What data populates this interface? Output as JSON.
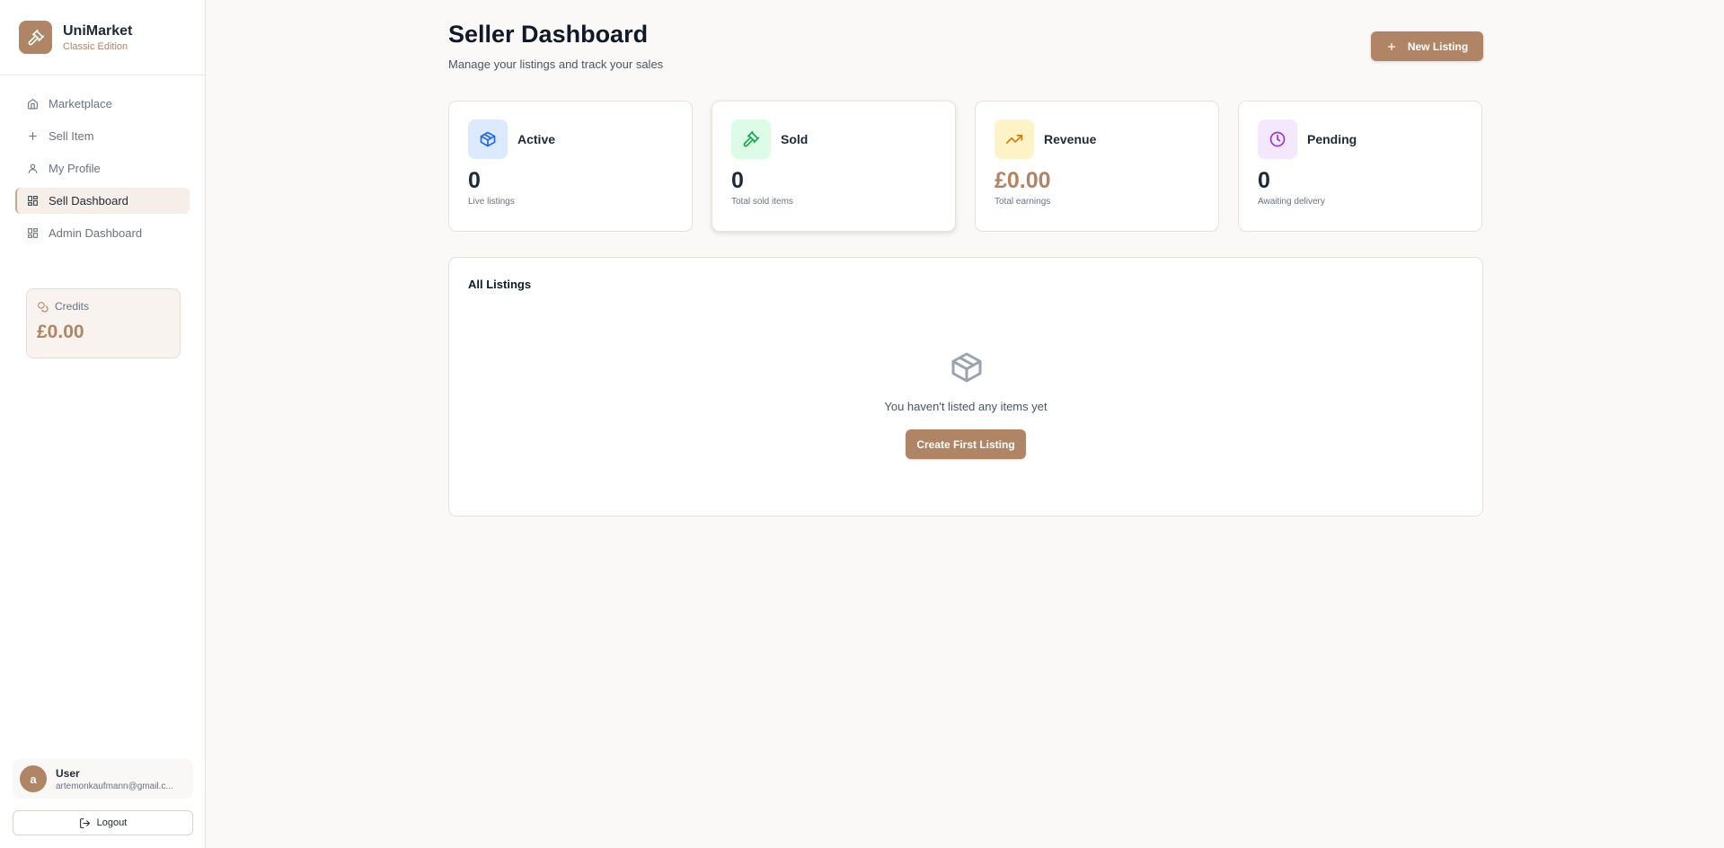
{
  "brand": {
    "name": "UniMarket",
    "subtitle": "Classic Edition",
    "accent": "#b08565"
  },
  "sidebar": {
    "items": [
      {
        "label": "Marketplace",
        "icon": "home-icon",
        "active": false
      },
      {
        "label": "Sell Item",
        "icon": "plus-icon",
        "active": false
      },
      {
        "label": "My Profile",
        "icon": "user-icon",
        "active": false
      },
      {
        "label": "Sell Dashboard",
        "icon": "dashboard-icon",
        "active": true
      },
      {
        "label": "Admin Dashboard",
        "icon": "dashboard-icon",
        "active": false
      }
    ],
    "credits": {
      "label": "Credits",
      "value": "£0.00"
    },
    "user": {
      "initial": "a",
      "name": "User",
      "email": "artemonkaufmann@gmail.c..."
    },
    "logout_label": "Logout"
  },
  "header": {
    "title": "Seller Dashboard",
    "subtitle": "Manage your listings and track your sales",
    "new_listing_label": "New Listing"
  },
  "stats": [
    {
      "label": "Active",
      "value": "0",
      "desc": "Live listings",
      "icon": "package-icon",
      "icon_color": "#2563eb",
      "icon_bg": "#dbeafe"
    },
    {
      "label": "Sold",
      "value": "0",
      "desc": "Total sold items",
      "icon": "gavel-icon",
      "icon_color": "#16a34a",
      "icon_bg": "#dcfce7"
    },
    {
      "label": "Revenue",
      "value": "£0.00",
      "desc": "Total earnings",
      "icon": "trending-up-icon",
      "icon_color": "#d97706",
      "icon_bg": "#fef3c7"
    },
    {
      "label": "Pending",
      "value": "0",
      "desc": "Awaiting delivery",
      "icon": "clock-icon",
      "icon_color": "#9333ea",
      "icon_bg": "#f3e8ff"
    }
  ],
  "listings": {
    "title": "All Listings",
    "empty_text": "You haven't listed any items yet",
    "create_label": "Create First Listing"
  }
}
